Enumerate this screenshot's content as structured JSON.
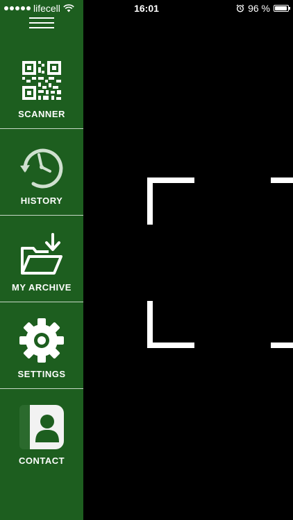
{
  "status_bar": {
    "carrier": "lifecell",
    "time": "16:01",
    "battery_text": "96 %",
    "battery_level": 0.96
  },
  "sidebar": {
    "background": "#1d5e1f",
    "items": [
      {
        "label": "SCANNER",
        "icon": "qr-code-icon"
      },
      {
        "label": "HISTORY",
        "icon": "clock-history-icon"
      },
      {
        "label": "MY ARCHIVE",
        "icon": "folder-download-icon"
      },
      {
        "label": "SETTINGS",
        "icon": "gear-icon"
      },
      {
        "label": "CONTACT",
        "icon": "contact-card-icon"
      }
    ]
  }
}
